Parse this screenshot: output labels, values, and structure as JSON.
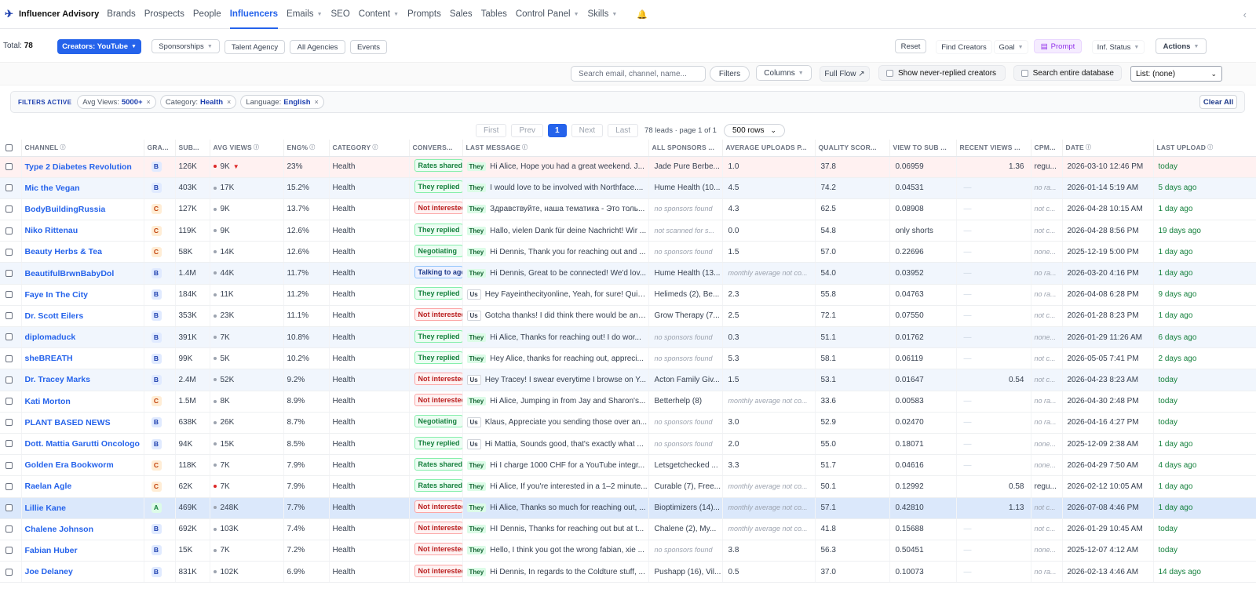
{
  "nav": {
    "brand": "Influencer Advisory",
    "items": [
      {
        "label": "Brands",
        "caret": false,
        "active": false
      },
      {
        "label": "Prospects",
        "caret": false,
        "active": false
      },
      {
        "label": "People",
        "caret": false,
        "active": false
      },
      {
        "label": "Influencers",
        "caret": false,
        "active": true
      },
      {
        "label": "Emails",
        "caret": true,
        "active": false
      },
      {
        "label": "SEO",
        "caret": false,
        "active": false
      },
      {
        "label": "Content",
        "caret": true,
        "active": false
      },
      {
        "label": "Prompts",
        "caret": false,
        "active": false
      },
      {
        "label": "Sales",
        "caret": false,
        "active": false
      },
      {
        "label": "Tables",
        "caret": false,
        "active": false
      },
      {
        "label": "Control Panel",
        "caret": true,
        "active": false
      },
      {
        "label": "Skills",
        "caret": true,
        "active": false
      }
    ]
  },
  "toolbar": {
    "total_label": "Total:",
    "total_value": "78",
    "creators": "Creators: YouTube",
    "sponsorships": "Sponsorships",
    "talent_agency": "Talent Agency",
    "all_agencies": "All Agencies",
    "events": "Events",
    "reset": "Reset",
    "find_creators": "Find Creators",
    "goal": "Goal",
    "prompt": "Prompt",
    "inf_status": "Inf. Status",
    "actions": "Actions"
  },
  "search": {
    "placeholder": "Search email, channel, name...",
    "filters": "Filters",
    "columns": "Columns",
    "full_flow": "Full Flow ↗",
    "never_replied": "Show never-replied creators",
    "entire_db": "Search entire database",
    "list": "List: (none)"
  },
  "filters": {
    "label": "FILTERS ACTIVE",
    "chips": [
      {
        "key": "Avg Views:",
        "value": "5000+"
      },
      {
        "key": "Category:",
        "value": "Health"
      },
      {
        "key": "Language:",
        "value": "English"
      }
    ],
    "clear_all": "Clear All"
  },
  "pager": {
    "first": "First",
    "prev": "Prev",
    "current": "1",
    "next": "Next",
    "last": "Last",
    "info": "78 leads · page 1 of 1",
    "rows": "500 rows"
  },
  "columns": [
    "CHANNEL",
    "GRA...",
    "SUB...",
    "AVG VIEWS",
    "ENG%",
    "CATEGORY",
    "CONVERS...",
    "LAST MESSAGE",
    "ALL SPONSORS ...",
    "AVERAGE UPLOADS P...",
    "QUALITY SCOR...",
    "VIEW TO SUB ...",
    "RECENT VIEWS ...",
    "CPM...",
    "DATE",
    "LAST UPLOAD"
  ],
  "rows": [
    {
      "channel": "Type 2 Diabetes Revolution",
      "grade": "B",
      "subs": "126K",
      "views": "9K",
      "views_dot": "red",
      "views_trend": "▼",
      "eng": "23%",
      "category": "Health",
      "conv": "Rates shared",
      "conv_style": "green",
      "who": "They",
      "message": "Hi Alice, Hope you had a great weekend. J...",
      "sponsors": "Jade Pure Berbe...",
      "sponsors_muted": false,
      "uploads": "1.0",
      "quality": "37.8",
      "vts": "0.06959",
      "recent": "1.36",
      "cpm": "regu...",
      "cpm_muted": false,
      "date": "2026-03-10 12:46 PM",
      "last": "today",
      "last_green": true,
      "style": "red"
    },
    {
      "channel": "Mic the Vegan",
      "grade": "B",
      "subs": "403K",
      "views": "17K",
      "views_dot": "grey",
      "views_trend": "",
      "eng": "15.2%",
      "category": "Health",
      "conv": "They replied",
      "conv_style": "green",
      "who": "They",
      "message": "I would love to be involved with Northface....",
      "sponsors": "Hume Health (10...",
      "sponsors_muted": false,
      "uploads": "4.5",
      "quality": "74.2",
      "vts": "0.04531",
      "recent": "—",
      "cpm": "no ra...",
      "cpm_muted": true,
      "date": "2026-01-14 5:19 AM",
      "last": "5 days ago",
      "last_green": true,
      "style": "blue"
    },
    {
      "channel": "BodyBuildingRussia",
      "grade": "C",
      "subs": "127K",
      "views": "9K",
      "views_dot": "grey",
      "views_trend": "",
      "eng": "13.7%",
      "category": "Health",
      "conv": "Not interested",
      "conv_style": "red",
      "who": "They",
      "message": "Здравствуйте, наша тематика - Это толь...",
      "sponsors": "no sponsors found",
      "sponsors_muted": true,
      "uploads": "4.3",
      "quality": "62.5",
      "vts": "0.08908",
      "recent": "—",
      "cpm": "not c...",
      "cpm_muted": true,
      "date": "2026-04-28 10:15 AM",
      "last": "1 day ago",
      "last_green": true,
      "style": ""
    },
    {
      "channel": "Niko Rittenau",
      "grade": "C",
      "subs": "119K",
      "views": "9K",
      "views_dot": "grey",
      "views_trend": "",
      "eng": "12.6%",
      "category": "Health",
      "conv": "They replied",
      "conv_style": "green",
      "who": "They",
      "message": "Hallo, vielen Dank für deine Nachricht! Wir ...",
      "sponsors": "not scanned for s...",
      "sponsors_muted": true,
      "uploads": "0.0",
      "quality": "54.8",
      "vts": "only shorts",
      "recent": "—",
      "cpm": "not c...",
      "cpm_muted": true,
      "date": "2026-04-28 8:56 PM",
      "last": "19 days ago",
      "last_green": true,
      "style": ""
    },
    {
      "channel": "Beauty Herbs & Tea",
      "grade": "C",
      "subs": "58K",
      "views": "14K",
      "views_dot": "grey",
      "views_trend": "",
      "eng": "12.6%",
      "category": "Health",
      "conv": "Negotiating",
      "conv_style": "green",
      "who": "They",
      "message": "Hi Dennis, Thank you for reaching out and ...",
      "sponsors": "no sponsors found",
      "sponsors_muted": true,
      "uploads": "1.5",
      "quality": "57.0",
      "vts": "0.22696",
      "recent": "—",
      "cpm": "none...",
      "cpm_muted": true,
      "date": "2025-12-19 5:00 PM",
      "last": "1 day ago",
      "last_green": true,
      "style": ""
    },
    {
      "channel": "BeautifulBrwnBabyDol",
      "grade": "B",
      "subs": "1.4M",
      "views": "44K",
      "views_dot": "grey",
      "views_trend": "",
      "eng": "11.7%",
      "category": "Health",
      "conv": "Talking to agent",
      "conv_style": "blue",
      "who": "They",
      "message": "Hi Dennis, Great to be connected! We'd lov...",
      "sponsors": "Hume Health (13...",
      "sponsors_muted": false,
      "uploads": "monthly average not co...",
      "uploads_muted": true,
      "quality": "54.0",
      "vts": "0.03952",
      "recent": "—",
      "cpm": "no ra...",
      "cpm_muted": true,
      "date": "2026-03-20 4:16 PM",
      "last": "1 day ago",
      "last_green": true,
      "style": "blue"
    },
    {
      "channel": "Faye In The City",
      "grade": "B",
      "subs": "184K",
      "views": "11K",
      "views_dot": "grey",
      "views_trend": "",
      "eng": "11.2%",
      "category": "Health",
      "conv": "They replied",
      "conv_style": "green",
      "who": "Us",
      "message": "Hey Fayeinthecityonline, Yeah, for sure! Quic...",
      "sponsors": "Helimeds (2), Be...",
      "sponsors_muted": false,
      "uploads": "2.3",
      "quality": "55.8",
      "vts": "0.04763",
      "recent": "—",
      "cpm": "no ra...",
      "cpm_muted": true,
      "date": "2026-04-08 6:28 PM",
      "last": "9 days ago",
      "last_green": true,
      "style": ""
    },
    {
      "channel": "Dr. Scott Eilers",
      "grade": "B",
      "subs": "353K",
      "views": "23K",
      "views_dot": "grey",
      "views_trend": "",
      "eng": "11.1%",
      "category": "Health",
      "conv": "Not interested",
      "conv_style": "red",
      "who": "Us",
      "message": "Gotcha thanks! I did think there would be ano...",
      "sponsors": "Grow Therapy (7...",
      "sponsors_muted": false,
      "uploads": "2.5",
      "quality": "72.1",
      "vts": "0.07550",
      "recent": "—",
      "cpm": "not c...",
      "cpm_muted": true,
      "date": "2026-01-28 8:23 PM",
      "last": "1 day ago",
      "last_green": true,
      "style": ""
    },
    {
      "channel": "diplomaduck",
      "grade": "B",
      "subs": "391K",
      "views": "7K",
      "views_dot": "grey",
      "views_trend": "",
      "eng": "10.8%",
      "category": "Health",
      "conv": "They replied",
      "conv_style": "green",
      "who": "They",
      "message": "Hi Alice, Thanks for reaching out! I do wor...",
      "sponsors": "no sponsors found",
      "sponsors_muted": true,
      "uploads": "0.3",
      "quality": "51.1",
      "vts": "0.01762",
      "recent": "—",
      "cpm": "none...",
      "cpm_muted": true,
      "date": "2026-01-29 11:26 AM",
      "last": "6 days ago",
      "last_green": true,
      "style": "blue"
    },
    {
      "channel": "sheBREATH",
      "grade": "B",
      "subs": "99K",
      "views": "5K",
      "views_dot": "grey",
      "views_trend": "",
      "eng": "10.2%",
      "category": "Health",
      "conv": "They replied",
      "conv_style": "green",
      "who": "They",
      "message": "Hey Alice, thanks for reaching out, appreci...",
      "sponsors": "no sponsors found",
      "sponsors_muted": true,
      "uploads": "5.3",
      "quality": "58.1",
      "vts": "0.06119",
      "recent": "—",
      "cpm": "not c...",
      "cpm_muted": true,
      "date": "2026-05-05 7:41 PM",
      "last": "2 days ago",
      "last_green": true,
      "style": ""
    },
    {
      "channel": "Dr. Tracey Marks",
      "grade": "B",
      "subs": "2.4M",
      "views": "52K",
      "views_dot": "grey",
      "views_trend": "",
      "eng": "9.2%",
      "category": "Health",
      "conv": "Not interested",
      "conv_style": "red",
      "who": "Us",
      "message": "Hey Tracey! I swear everytime I browse on Y...",
      "sponsors": "Acton Family Giv...",
      "sponsors_muted": false,
      "uploads": "1.5",
      "quality": "53.1",
      "vts": "0.01647",
      "recent": "0.54",
      "cpm": "not c...",
      "cpm_muted": true,
      "date": "2026-04-23 8:23 AM",
      "last": "today",
      "last_green": true,
      "style": "blue"
    },
    {
      "channel": "Kati Morton",
      "grade": "C",
      "subs": "1.5M",
      "views": "8K",
      "views_dot": "grey",
      "views_trend": "",
      "eng": "8.9%",
      "category": "Health",
      "conv": "Not interested",
      "conv_style": "red",
      "who": "They",
      "message": "Hi Alice, Jumping in from Jay and Sharon's...",
      "sponsors": "Betterhelp (8)",
      "sponsors_muted": false,
      "uploads": "monthly average not co...",
      "uploads_muted": true,
      "quality": "33.6",
      "vts": "0.00583",
      "recent": "—",
      "cpm": "no ra...",
      "cpm_muted": true,
      "date": "2026-04-30 2:48 PM",
      "last": "today",
      "last_green": true,
      "style": ""
    },
    {
      "channel": "PLANT BASED NEWS",
      "grade": "B",
      "subs": "638K",
      "views": "26K",
      "views_dot": "grey",
      "views_trend": "",
      "eng": "8.7%",
      "category": "Health",
      "conv": "Negotiating",
      "conv_style": "green",
      "who": "Us",
      "message": "Klaus, Appreciate you sending those over an...",
      "sponsors": "no sponsors found",
      "sponsors_muted": true,
      "uploads": "3.0",
      "quality": "52.9",
      "vts": "0.02470",
      "recent": "—",
      "cpm": "no ra...",
      "cpm_muted": true,
      "date": "2026-04-16 4:27 PM",
      "last": "today",
      "last_green": true,
      "style": ""
    },
    {
      "channel": "Dott. Mattia Garutti Oncologo",
      "grade": "B",
      "subs": "94K",
      "views": "15K",
      "views_dot": "grey",
      "views_trend": "",
      "eng": "8.5%",
      "category": "Health",
      "conv": "They replied",
      "conv_style": "green",
      "who": "Us",
      "message": "Hi Mattia, Sounds good, that's exactly what ...",
      "sponsors": "no sponsors found",
      "sponsors_muted": true,
      "uploads": "2.0",
      "quality": "55.0",
      "vts": "0.18071",
      "recent": "—",
      "cpm": "none...",
      "cpm_muted": true,
      "date": "2025-12-09 2:38 AM",
      "last": "1 day ago",
      "last_green": true,
      "style": ""
    },
    {
      "channel": "Golden Era Bookworm",
      "grade": "C",
      "subs": "118K",
      "views": "7K",
      "views_dot": "grey",
      "views_trend": "",
      "eng": "7.9%",
      "category": "Health",
      "conv": "Rates shared",
      "conv_style": "green",
      "who": "They",
      "message": "Hi I charge 1000 CHF for a YouTube integr...",
      "sponsors": "Letsgetchecked ...",
      "sponsors_muted": false,
      "uploads": "3.3",
      "quality": "51.7",
      "vts": "0.04616",
      "recent": "—",
      "cpm": "none...",
      "cpm_muted": true,
      "date": "2026-04-29 7:50 AM",
      "last": "4 days ago",
      "last_green": true,
      "style": ""
    },
    {
      "channel": "Raelan Agle",
      "grade": "C",
      "subs": "62K",
      "views": "7K",
      "views_dot": "red",
      "views_trend": "",
      "eng": "7.9%",
      "category": "Health",
      "conv": "Rates shared",
      "conv_style": "green",
      "who": "They",
      "message": "Hi Alice, If you're interested in a 1–2 minute...",
      "sponsors": "Curable (7), Free...",
      "sponsors_muted": false,
      "uploads": "monthly average not co...",
      "uploads_muted": true,
      "quality": "50.1",
      "vts": "0.12992",
      "recent": "0.58",
      "cpm": "regu...",
      "cpm_muted": false,
      "date": "2026-02-12 10:05 AM",
      "last": "1 day ago",
      "last_green": true,
      "style": ""
    },
    {
      "channel": "Lillie Kane",
      "grade": "A",
      "subs": "469K",
      "views": "248K",
      "views_dot": "grey",
      "views_trend": "",
      "eng": "7.7%",
      "category": "Health",
      "conv": "Not interested",
      "conv_style": "red",
      "who": "They",
      "message": "Hi Alice, Thanks so much for reaching out, ...",
      "sponsors": "Bioptimizers (14)...",
      "sponsors_muted": false,
      "uploads": "monthly average not co...",
      "uploads_muted": true,
      "quality": "57.1",
      "vts": "0.42810",
      "recent": "1.13",
      "cpm": "not c...",
      "cpm_muted": true,
      "date": "2026-07-08 4:46 PM",
      "last": "1 day ago",
      "last_green": true,
      "style": "sel"
    },
    {
      "channel": "Chalene Johnson",
      "grade": "B",
      "subs": "692K",
      "views": "103K",
      "views_dot": "grey",
      "views_trend": "",
      "eng": "7.4%",
      "category": "Health",
      "conv": "Not interested",
      "conv_style": "red",
      "who": "They",
      "message": "HI Dennis, Thanks for reaching out but at t...",
      "sponsors": "Chalene (2), My...",
      "sponsors_muted": false,
      "uploads": "monthly average not co...",
      "uploads_muted": true,
      "quality": "41.8",
      "vts": "0.15688",
      "recent": "—",
      "cpm": "not c...",
      "cpm_muted": true,
      "date": "2026-01-29 10:45 AM",
      "last": "today",
      "last_green": true,
      "style": ""
    },
    {
      "channel": "Fabian Huber",
      "grade": "B",
      "subs": "15K",
      "views": "7K",
      "views_dot": "grey",
      "views_trend": "",
      "eng": "7.2%",
      "category": "Health",
      "conv": "Not interested",
      "conv_style": "red",
      "who": "They",
      "message": "Hello, I think you got the wrong fabian, xie ...",
      "sponsors": "no sponsors found",
      "sponsors_muted": true,
      "uploads": "3.8",
      "quality": "56.3",
      "vts": "0.50451",
      "recent": "—",
      "cpm": "none...",
      "cpm_muted": true,
      "date": "2025-12-07 4:12 AM",
      "last": "today",
      "last_green": true,
      "style": ""
    },
    {
      "channel": "Joe Delaney",
      "grade": "B",
      "subs": "831K",
      "views": "102K",
      "views_dot": "grey",
      "views_trend": "",
      "eng": "6.9%",
      "category": "Health",
      "conv": "Not interested",
      "conv_style": "red",
      "who": "They",
      "message": "Hi Dennis, In regards to the Coldture stuff, ...",
      "sponsors": "Pushapp (16), Vil...",
      "sponsors_muted": false,
      "uploads": "0.5",
      "quality": "37.0",
      "vts": "0.10073",
      "recent": "—",
      "cpm": "no ra...",
      "cpm_muted": true,
      "date": "2026-02-13 4:46 AM",
      "last": "14 days ago",
      "last_green": true,
      "style": ""
    }
  ]
}
